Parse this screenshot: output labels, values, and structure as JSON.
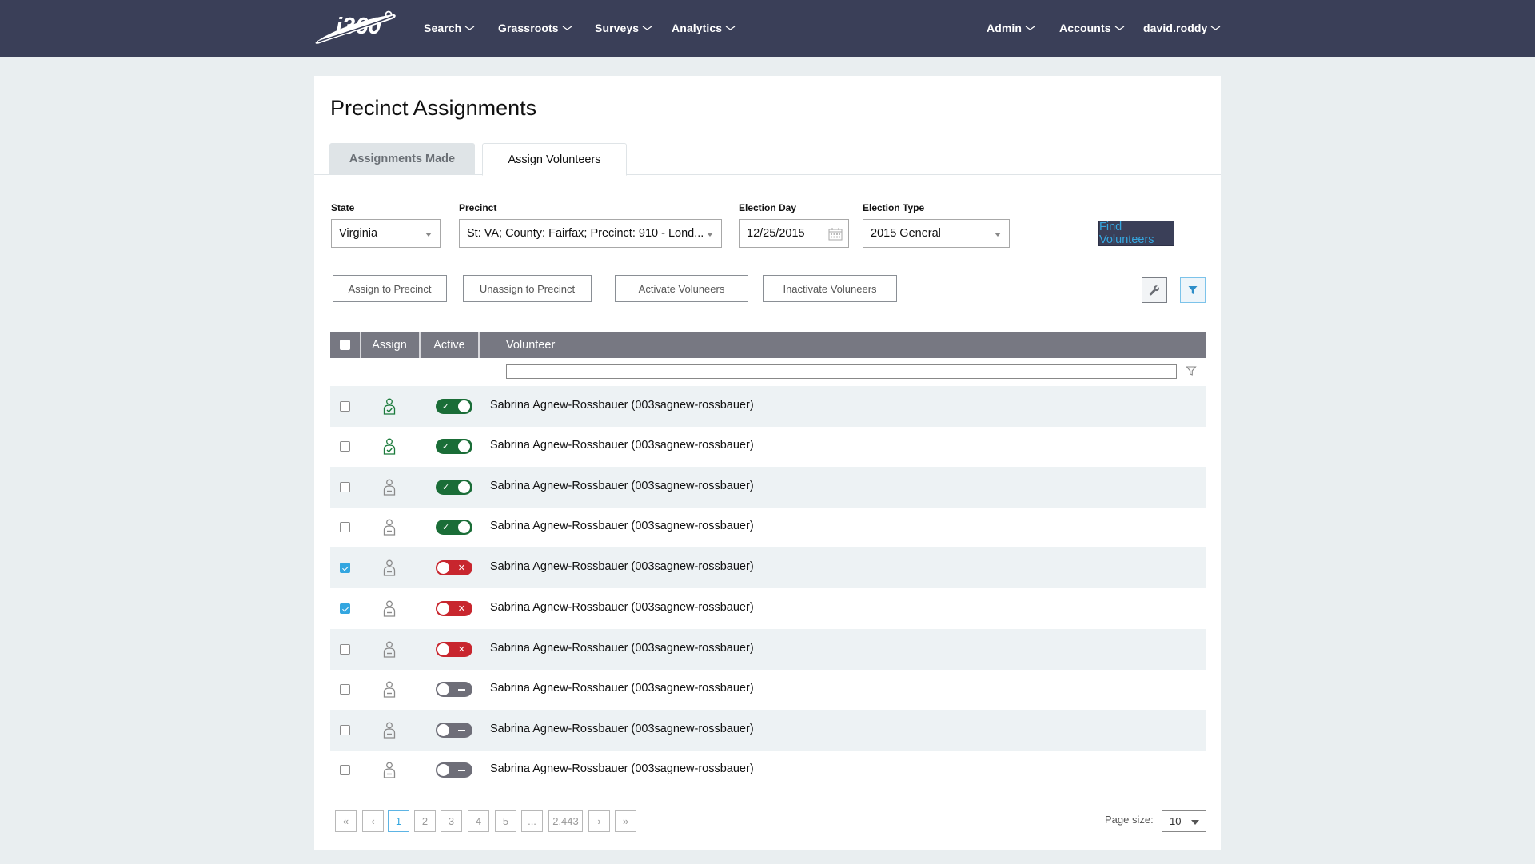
{
  "nav": {
    "logo_text": "i360",
    "left_items": [
      {
        "label": "Search"
      },
      {
        "label": "Grassroots"
      },
      {
        "label": "Surveys"
      },
      {
        "label": "Analytics"
      }
    ],
    "right_items": [
      {
        "label": "Admin"
      },
      {
        "label": "Accounts"
      },
      {
        "label": "david.roddy"
      }
    ]
  },
  "page": {
    "title": "Precinct Assignments",
    "tabs": [
      {
        "label": "Assignments Made",
        "active": false
      },
      {
        "label": "Assign Volunteers",
        "active": true
      }
    ]
  },
  "filters": {
    "state": {
      "label": "State",
      "value": "Virginia"
    },
    "precinct": {
      "label": "Precinct",
      "value": "St: VA; County: Fairfax; Precinct: 910 - Lond..."
    },
    "election_day": {
      "label": "Election Day",
      "value": "12/25/2015"
    },
    "election_type": {
      "label": "Election Type",
      "value": "2015 General"
    },
    "find_button": "Find Volunteers"
  },
  "actions": {
    "assign": "Assign to Precinct",
    "unassign": "Unassign to Precinct",
    "activate": "Activate Voluneers",
    "inactivate": "Inactivate Voluneers"
  },
  "grid": {
    "columns": {
      "assign": "Assign",
      "active": "Active",
      "volunteer": "Volunteer"
    },
    "filter_value": "",
    "rows": [
      {
        "checked": false,
        "assigned": true,
        "active_state": "active",
        "volunteer": "Sabrina Agnew-Rossbauer (003sagnew-rossbauer)"
      },
      {
        "checked": false,
        "assigned": true,
        "active_state": "active",
        "volunteer": "Sabrina Agnew-Rossbauer (003sagnew-rossbauer)"
      },
      {
        "checked": false,
        "assigned": false,
        "active_state": "active",
        "volunteer": "Sabrina Agnew-Rossbauer (003sagnew-rossbauer)"
      },
      {
        "checked": false,
        "assigned": false,
        "active_state": "active",
        "volunteer": "Sabrina Agnew-Rossbauer (003sagnew-rossbauer)"
      },
      {
        "checked": true,
        "assigned": false,
        "active_state": "inactive",
        "volunteer": "Sabrina Agnew-Rossbauer (003sagnew-rossbauer)"
      },
      {
        "checked": true,
        "assigned": false,
        "active_state": "inactive",
        "volunteer": "Sabrina Agnew-Rossbauer (003sagnew-rossbauer)"
      },
      {
        "checked": false,
        "assigned": false,
        "active_state": "inactive",
        "volunteer": "Sabrina Agnew-Rossbauer (003sagnew-rossbauer)"
      },
      {
        "checked": false,
        "assigned": false,
        "active_state": "unset",
        "volunteer": "Sabrina Agnew-Rossbauer (003sagnew-rossbauer)"
      },
      {
        "checked": false,
        "assigned": false,
        "active_state": "unset",
        "volunteer": "Sabrina Agnew-Rossbauer (003sagnew-rossbauer)"
      },
      {
        "checked": false,
        "assigned": false,
        "active_state": "unset",
        "volunteer": "Sabrina Agnew-Rossbauer (003sagnew-rossbauer)"
      }
    ]
  },
  "pager": {
    "first": "«",
    "prev": "‹",
    "pages": [
      "1",
      "2",
      "3",
      "4",
      "5"
    ],
    "current": "1",
    "ellipsis": "...",
    "last_page": "2,443",
    "next": "›",
    "last": "»",
    "page_size_label": "Page size:",
    "page_size": "10"
  },
  "colors": {
    "navbar": "#3a3f58",
    "accent_blue": "#33a6e0",
    "active_green": "#1a6d37",
    "inactive_red": "#c8262e",
    "unset_gray": "#6e6e78",
    "grid_header": "#777882"
  }
}
